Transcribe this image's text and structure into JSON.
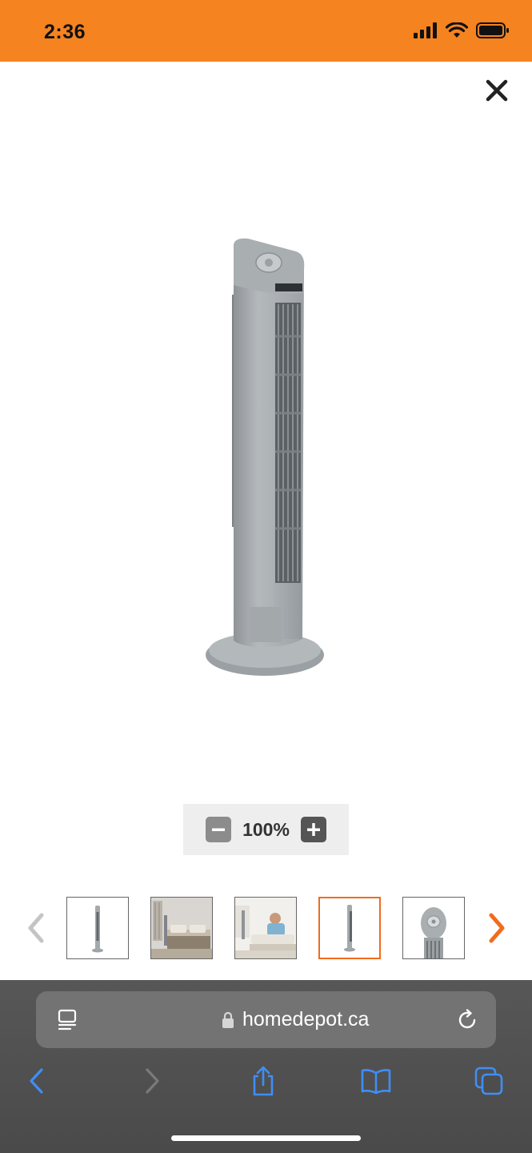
{
  "status_bar": {
    "time": "2:36",
    "background": "#f58320"
  },
  "viewer": {
    "close_icon": "close-icon",
    "zoom": {
      "level": "100%",
      "minus_icon": "minus-icon",
      "plus_icon": "plus-icon"
    },
    "thumbnails": [
      {
        "name": "tower-fan-front"
      },
      {
        "name": "tower-fan-bedroom"
      },
      {
        "name": "tower-fan-living-room"
      },
      {
        "name": "tower-fan-side",
        "selected": true
      },
      {
        "name": "tower-fan-control-panel"
      }
    ],
    "accent": "#f26b1d"
  },
  "browser": {
    "url": "homedepot.ca",
    "icons": [
      "reader-icon",
      "lock-icon",
      "reload-icon",
      "back-icon",
      "forward-icon",
      "share-icon",
      "bookmarks-icon",
      "tabs-icon"
    ],
    "tint": "#3f8ef7"
  }
}
